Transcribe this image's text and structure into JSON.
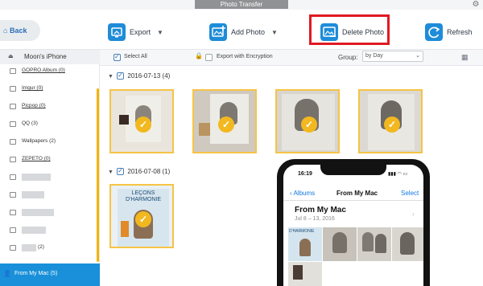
{
  "window": {
    "title": "Photo Transfer"
  },
  "toolbar": {
    "back_label": "Back",
    "export_label": "Export",
    "add_photo_label": "Add Photo",
    "delete_photo_label": "Delete Photo",
    "refresh_label": "Refresh"
  },
  "sidebar": {
    "device_name": "Moon's iPhone",
    "items": [
      {
        "label": "GOPRO Album (0)"
      },
      {
        "label": "Imgur (0)"
      },
      {
        "label": "Picpop (0)"
      },
      {
        "label": "QQ (3)"
      },
      {
        "label": "Wallpapers (2)"
      },
      {
        "label": "ZEPETO (0)"
      },
      {
        "label": ""
      },
      {
        "label": ""
      },
      {
        "label": ""
      },
      {
        "label": ""
      },
      {
        "label": "(2)"
      }
    ],
    "active_item": "From My Mac (5)"
  },
  "actions": {
    "select_all_label": "Select All",
    "export_encryption_label": "Export with Encryption",
    "group_label": "Group:",
    "group_value": "by Day"
  },
  "groups": [
    {
      "date": "2016-07-13 (4)"
    },
    {
      "date": "2016-07-08 (1)"
    }
  ],
  "book_cover": {
    "line1": "LEÇONS",
    "line2": "D'HARMONIE"
  },
  "phone": {
    "time": "16:19",
    "back_label": "Albums",
    "nav_title": "From My Mac",
    "select_label": "Select",
    "album_title": "From My Mac",
    "album_dates": "Jul 8 – 13, 2016",
    "thumb_text": "D'HARMONIE"
  },
  "colors": {
    "accent": "#1990d9",
    "highlight": "#e01a22",
    "selection": "#f6c445"
  }
}
